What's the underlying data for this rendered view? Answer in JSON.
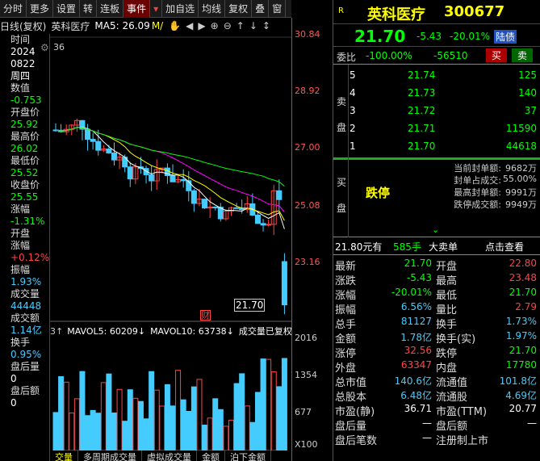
{
  "toolbar": {
    "items": [
      "分时",
      "更多",
      "设置",
      "转",
      "连板",
      "事件",
      "▾",
      "加自选",
      "均线",
      "复权",
      "叠",
      "窗"
    ]
  },
  "chartbar": {
    "mode": "日线(复权)",
    "name": "英科医疗",
    "ma_label": "MA5: 26.09",
    "ma_more": "M/"
  },
  "left": {
    "rows": [
      {
        "t": "时间",
        "c": "lbl"
      },
      {
        "t": "2024",
        "c": "val"
      },
      {
        "t": "0822",
        "c": "val"
      },
      {
        "t": "周四",
        "c": "val"
      },
      {
        "t": "数值",
        "c": "lbl"
      },
      {
        "t": "-0.753",
        "c": "g"
      },
      {
        "t": "开盘价",
        "c": "lbl"
      },
      {
        "t": "25.92",
        "c": "g"
      },
      {
        "t": "最高价",
        "c": "lbl"
      },
      {
        "t": "26.02",
        "c": "g"
      },
      {
        "t": "最低价",
        "c": "lbl"
      },
      {
        "t": "25.52",
        "c": "g"
      },
      {
        "t": "收盘价",
        "c": "lbl"
      },
      {
        "t": "25.55",
        "c": "g"
      },
      {
        "t": "涨幅",
        "c": "lbl"
      },
      {
        "t": "-1.31%",
        "c": "g"
      },
      {
        "t": "开盘",
        "c": "lbl"
      },
      {
        "t": "涨幅",
        "c": "lbl"
      },
      {
        "t": "+0.12%",
        "c": "r"
      },
      {
        "t": "振幅",
        "c": "lbl"
      },
      {
        "t": "1.93%",
        "c": "c"
      },
      {
        "t": "成交量",
        "c": "lbl"
      },
      {
        "t": "44448",
        "c": "c"
      },
      {
        "t": "成交额",
        "c": "lbl"
      },
      {
        "t": "1.14亿",
        "c": "c"
      },
      {
        "t": "换手",
        "c": "lbl"
      },
      {
        "t": "0.95%",
        "c": "c"
      },
      {
        "t": "盘后量",
        "c": "lbl"
      },
      {
        "t": "0",
        "c": "val"
      },
      {
        "t": "盘后额",
        "c": "lbl"
      },
      {
        "t": "0",
        "c": "val"
      }
    ],
    "marker": "36"
  },
  "price_axis": [
    "30.84",
    "28.92",
    "27.00",
    "25.08",
    "23.16"
  ],
  "vol_axis": [
    "2016",
    "1354",
    "677",
    "X100"
  ],
  "price_box": "21.70",
  "cai": "财",
  "vol_header": {
    "a": "3↑",
    "b": "MAVOL5: 60209↓",
    "c": "MAVOL10: 63738↓",
    "d": "成交量已复权"
  },
  "tabs": [
    "交量",
    "多周期成交量",
    "虚拟成交量",
    "金额",
    "泊下金额"
  ],
  "quote": {
    "name": "英科医疗",
    "code": "300677",
    "badge": "R",
    "price": "21.70",
    "change": "-5.43",
    "pct": "-20.01%",
    "tag": "陆债",
    "wb_label": "委比",
    "wb_pct": "-100.00%",
    "wb_diff": "-56510",
    "buy_btn": "买",
    "sell_btn": "卖",
    "sell_label": "卖盘",
    "buy_label": "买盘",
    "asks": [
      {
        "n": "5",
        "p": "21.74",
        "v": "125"
      },
      {
        "n": "4",
        "p": "21.73",
        "v": "140"
      },
      {
        "n": "3",
        "p": "21.72",
        "v": "37"
      },
      {
        "n": "2",
        "p": "21.71",
        "v": "11590"
      },
      {
        "n": "1",
        "p": "21.70",
        "v": "44618"
      }
    ],
    "limit_text": "跌停",
    "limit_info": [
      [
        "当前封单额:",
        "9682万"
      ],
      [
        "封单占成交:",
        "55.00%"
      ],
      [
        "最高封单额:",
        "9991万"
      ],
      [
        "跌停成交额:",
        "9949万"
      ]
    ],
    "big_order": {
      "price": "21.80元有",
      "vol": "585手",
      "label": "大卖单",
      "link": "点击查看"
    },
    "stats": [
      [
        [
          "最新",
          "21.70",
          "g"
        ],
        [
          "开盘",
          "22.80",
          "r"
        ]
      ],
      [
        [
          "涨跌",
          "-5.43",
          "g"
        ],
        [
          "最高",
          "23.48",
          "r"
        ]
      ],
      [
        [
          "涨幅",
          "-20.01%",
          "g"
        ],
        [
          "最低",
          "21.70",
          "g"
        ]
      ],
      [
        [
          "振幅",
          "6.56%",
          "c"
        ],
        [
          "量比",
          "2.79",
          "r"
        ]
      ],
      [
        [
          "总手",
          "81127",
          "c"
        ],
        [
          "换手",
          "1.73%",
          "c"
        ]
      ],
      [
        [
          "金额",
          "1.78亿",
          "c"
        ],
        [
          "换手(实)",
          "1.97%",
          "c"
        ]
      ],
      [
        [
          "涨停",
          "32.56",
          "r"
        ],
        [
          "跌停",
          "21.70",
          "g"
        ]
      ],
      [
        [
          "外盘",
          "63347",
          "r"
        ],
        [
          "内盘",
          "17780",
          "g"
        ]
      ],
      [
        [
          "总市值",
          "140.6亿",
          "c"
        ],
        [
          "流通值",
          "101.8亿",
          "c"
        ]
      ],
      [
        [
          "总股本",
          "6.48亿",
          "c"
        ],
        [
          "流通股",
          "4.69亿",
          "c"
        ]
      ],
      [
        [
          "市盈(静)",
          "36.71",
          "w"
        ],
        [
          "市盈(TTM)",
          "20.77",
          "w"
        ]
      ],
      [
        [
          "盘后量",
          "—",
          "w"
        ],
        [
          "盘后额",
          "—",
          "w"
        ]
      ],
      [
        [
          "盘后笔数",
          "—",
          "w"
        ],
        [
          "注册制上市",
          "",
          "w"
        ]
      ]
    ]
  }
}
